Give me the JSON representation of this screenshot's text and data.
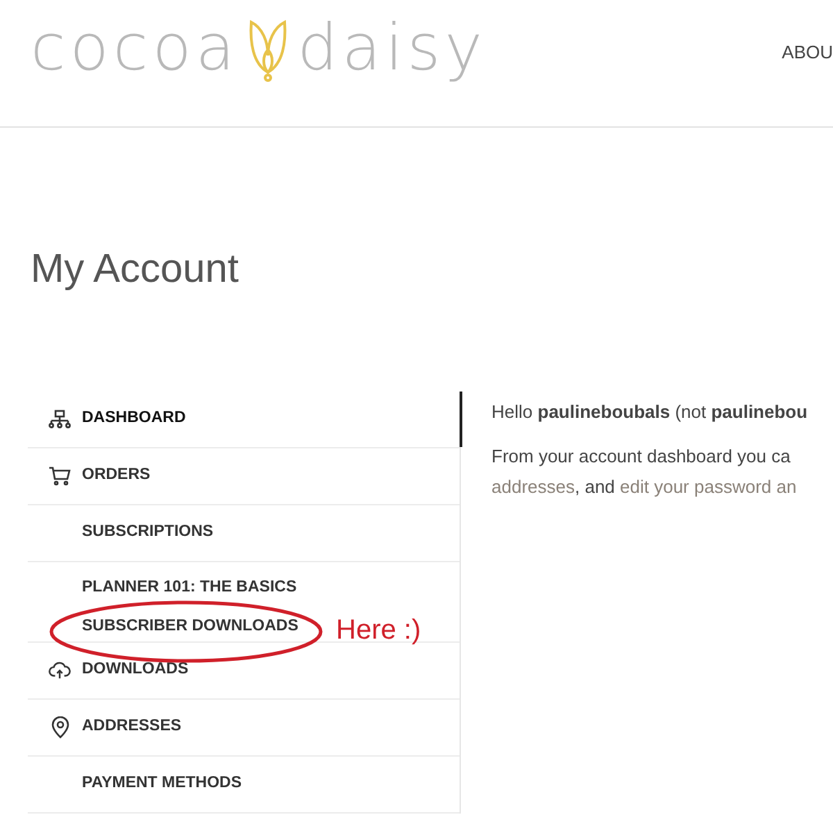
{
  "header": {
    "logo_left": "cocoa",
    "logo_right": "daisy",
    "nav": [
      "ABOU"
    ]
  },
  "page_title": "My Account",
  "account_nav": [
    {
      "label": "DASHBOARD",
      "kind": "sitemap",
      "selected": true
    },
    {
      "label": "ORDERS",
      "kind": "cart",
      "selected": false
    },
    {
      "label": "SUBSCRIPTIONS",
      "kind": "plain",
      "selected": false
    },
    {
      "label": "PLANNER 101: THE BASICS",
      "kind": "plain",
      "selected": false,
      "children": [
        {
          "label": "SUBSCRIBER DOWNLOADS",
          "selected": false
        }
      ]
    },
    {
      "label": "DOWNLOADS",
      "kind": "cloud",
      "selected": false
    },
    {
      "label": "ADDRESSES",
      "kind": "pin",
      "selected": false
    },
    {
      "label": "PAYMENT METHODS",
      "kind": "plain",
      "selected": false
    }
  ],
  "content": {
    "greeting": "Hello **paulineboubals** (not **paulinebou**",
    "intro": "From your account dashboard you ca",
    "links": [
      "addresses",
      ", and ",
      "edit your password an"
    ]
  },
  "annotation": {
    "text": "Here :)"
  }
}
